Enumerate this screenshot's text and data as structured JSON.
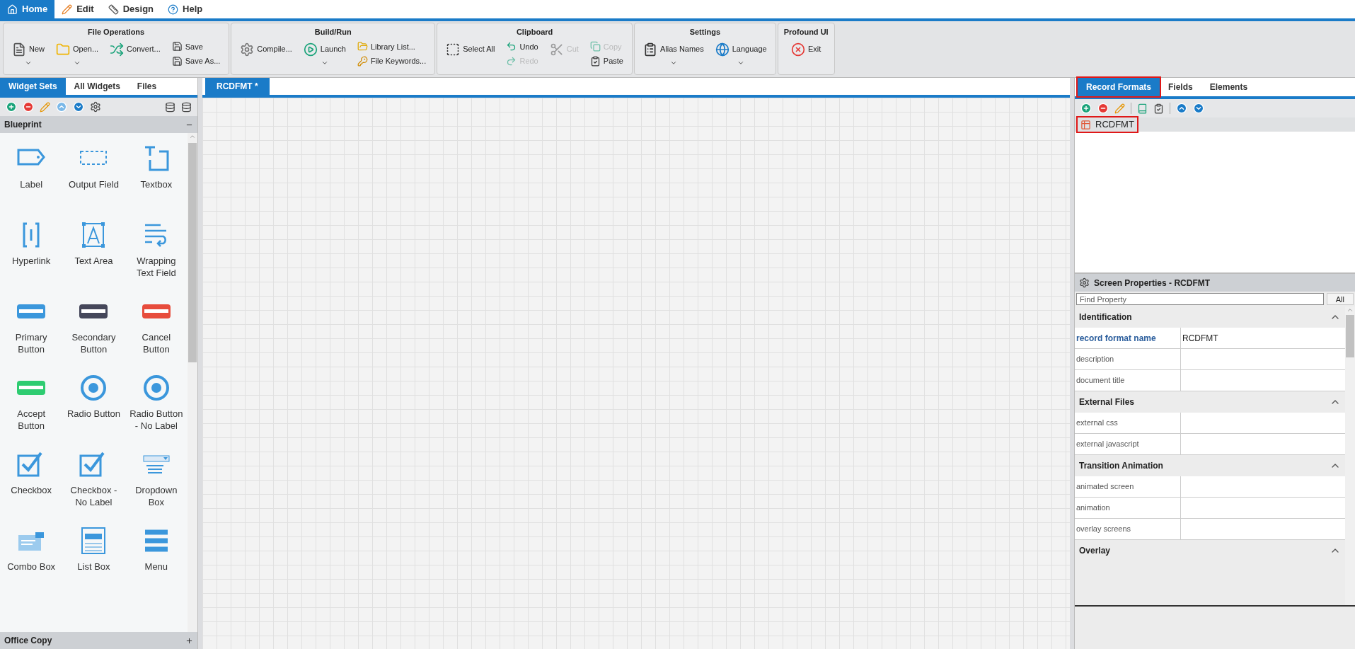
{
  "menu": [
    {
      "label": "Home",
      "selected": true
    },
    {
      "label": "Edit",
      "selected": false
    },
    {
      "label": "Design",
      "selected": false
    },
    {
      "label": "Help",
      "selected": false
    }
  ],
  "ribbon": [
    {
      "title": "File Operations",
      "buttons": [
        {
          "label": "New",
          "kind": "large",
          "has_menu": true,
          "disabled": false
        },
        {
          "label": "Open...",
          "kind": "large",
          "has_menu": true,
          "disabled": false
        },
        {
          "label": "Convert...",
          "kind": "large",
          "has_menu": false,
          "disabled": false
        },
        {
          "label": "Save",
          "kind": "small",
          "disabled": false
        },
        {
          "label": "Save As...",
          "kind": "small",
          "disabled": false
        }
      ]
    },
    {
      "title": "Build/Run",
      "buttons": [
        {
          "label": "Compile...",
          "kind": "large",
          "has_menu": false,
          "disabled": false
        },
        {
          "label": "Launch",
          "kind": "large",
          "has_menu": true,
          "disabled": false
        },
        {
          "label": "Library List...",
          "kind": "small",
          "disabled": false
        },
        {
          "label": "File Keywords...",
          "kind": "small",
          "disabled": false
        }
      ]
    },
    {
      "title": "Clipboard",
      "buttons": [
        {
          "label": "Select All",
          "kind": "large",
          "has_menu": false,
          "disabled": false
        },
        {
          "label": "Undo",
          "kind": "small",
          "disabled": false
        },
        {
          "label": "Redo",
          "kind": "small",
          "disabled": true
        },
        {
          "label": "Cut",
          "kind": "large",
          "has_menu": false,
          "disabled": true
        },
        {
          "label": "Copy",
          "kind": "small",
          "disabled": true
        },
        {
          "label": "Paste",
          "kind": "small",
          "disabled": false
        }
      ]
    },
    {
      "title": "Settings",
      "buttons": [
        {
          "label": "Alias Names",
          "kind": "large",
          "has_menu": true,
          "disabled": false
        },
        {
          "label": "Language",
          "kind": "large",
          "has_menu": true,
          "disabled": false
        }
      ]
    },
    {
      "title": "Profound UI",
      "buttons": [
        {
          "label": "Exit",
          "kind": "large",
          "has_menu": false,
          "disabled": false
        }
      ]
    }
  ],
  "left_panel": {
    "tabs": [
      {
        "label": "Widget Sets",
        "selected": true
      },
      {
        "label": "All Widgets",
        "selected": false
      },
      {
        "label": "Files",
        "selected": false
      }
    ],
    "section": {
      "title": "Blueprint",
      "expanded": true
    },
    "widgets": [
      {
        "label": "Label",
        "kind": "label"
      },
      {
        "label": "Output Field",
        "kind": "output"
      },
      {
        "label": "Textbox",
        "kind": "textbox"
      },
      {
        "label": "Hyperlink",
        "kind": "hyperlink"
      },
      {
        "label": "Text Area",
        "kind": "textarea"
      },
      {
        "label": "Wrapping Text Field",
        "kind": "wrapping"
      },
      {
        "label": "Primary Button",
        "kind": "button",
        "color": "#3b97dc"
      },
      {
        "label": "Secondary Button",
        "kind": "button",
        "color": "#45475a"
      },
      {
        "label": "Cancel Button",
        "kind": "button",
        "color": "#e74c3c"
      },
      {
        "label": "Accept Button",
        "kind": "button",
        "color": "#2ecc71"
      },
      {
        "label": "Radio Button",
        "kind": "radio"
      },
      {
        "label": "Radio Button - No Label",
        "kind": "radio"
      },
      {
        "label": "Checkbox",
        "kind": "checkbox"
      },
      {
        "label": "Checkbox - No Label",
        "kind": "checkbox"
      },
      {
        "label": "Dropdown Box",
        "kind": "dropdown"
      },
      {
        "label": "Combo Box",
        "kind": "combo"
      },
      {
        "label": "List Box",
        "kind": "listbox"
      },
      {
        "label": "Menu",
        "kind": "menu"
      }
    ],
    "footer_section": {
      "title": "Office Copy",
      "expanded": false
    }
  },
  "document_tabs": [
    {
      "label": "RCDFMT *",
      "selected": true
    }
  ],
  "right_panel": {
    "tabs": [
      {
        "label": "Record Formats",
        "selected": true,
        "highlighted": true
      },
      {
        "label": "Fields",
        "selected": false,
        "highlighted": false
      },
      {
        "label": "Elements",
        "selected": false,
        "highlighted": false
      }
    ],
    "tree": [
      {
        "label": "RCDFMT",
        "selected": true,
        "highlighted": true
      }
    ],
    "properties": {
      "title": "Screen Properties - RCDFMT",
      "search": {
        "placeholder": "Find Property"
      },
      "all_button": "All",
      "sections": [
        {
          "title": "Identification",
          "expanded": true,
          "rows": [
            {
              "name": "record format name",
              "value": "RCDFMT",
              "selected": true
            },
            {
              "name": "description",
              "selected": false
            },
            {
              "name": "document title",
              "selected": false
            }
          ]
        },
        {
          "title": "External Files",
          "expanded": true,
          "rows": [
            {
              "name": "external css",
              "selected": false
            },
            {
              "name": "external javascript",
              "selected": false
            }
          ]
        },
        {
          "title": "Transition Animation",
          "expanded": true,
          "rows": [
            {
              "name": "animated screen",
              "selected": false
            },
            {
              "name": "animation",
              "selected": false
            },
            {
              "name": "overlay screens",
              "selected": false
            }
          ]
        },
        {
          "title": "Overlay",
          "expanded": true
        }
      ]
    }
  }
}
